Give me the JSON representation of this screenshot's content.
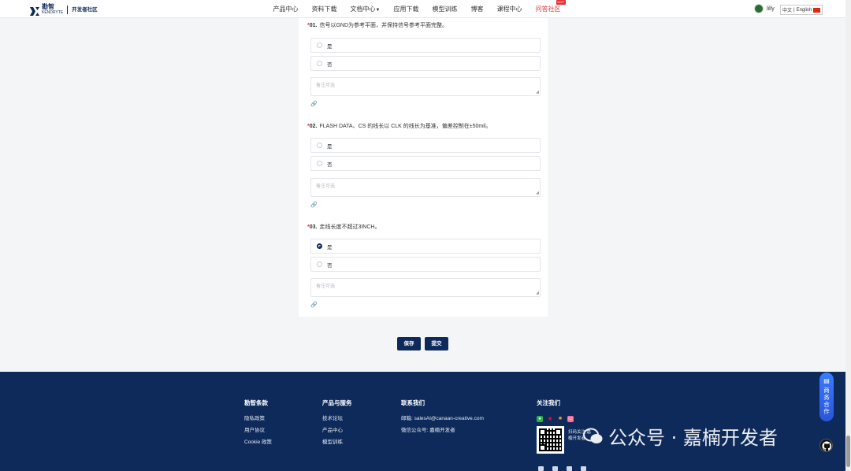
{
  "nav": {
    "logo_cn": "勘智",
    "logo_en": "KENDRYTE",
    "community": "开发者社区",
    "menu": [
      "产品中心",
      "资料下载",
      "文档中心",
      "应用下载",
      "模型训练",
      "博客",
      "课程中心",
      "问答社区"
    ],
    "hot_badge": "HOT",
    "username": "lilly",
    "lang_cn": "中文",
    "lang_sep": "|",
    "lang_en": "English"
  },
  "questions": [
    {
      "required": "*",
      "number": "01.",
      "text": "信号以GND为参考平面，并保持信号参考平面完整。",
      "options": [
        "是",
        "否"
      ],
      "selected": null,
      "remark_placeholder": "备注可选"
    },
    {
      "required": "*",
      "number": "02.",
      "text": "FLASH DATA、CS 的线长以 CLK 的线长为基准，偏差控制在±50mil。",
      "options": [
        "是",
        "否"
      ],
      "selected": null,
      "remark_placeholder": "备注可选"
    },
    {
      "required": "*",
      "number": "03.",
      "text": "走线长度不超过3INCH。",
      "options": [
        "是",
        "否"
      ],
      "selected": 0,
      "remark_placeholder": "备注可选"
    }
  ],
  "actions": {
    "save": "保存",
    "submit": "提交"
  },
  "footer": {
    "col1": {
      "title": "勘智条款",
      "links": [
        "隐私政策",
        "用户协议",
        "Cookie 政策"
      ]
    },
    "col2": {
      "title": "产品与服务",
      "links": [
        "技术论坛",
        "产品中心",
        "模型训练"
      ]
    },
    "col3": {
      "title": "联系我们",
      "links": [
        "邮箱: salesAI@canaan-creative.com",
        "微信公众号: 嘉楠开发者"
      ]
    },
    "col4": {
      "title": "关注我们",
      "qr_caption": "扫码关注 嘉楠开发者"
    },
    "social_icons": [
      "wechat-icon",
      "weibo-icon",
      "bilibili-butterfly-icon",
      "bilibili-icon"
    ]
  },
  "float": {
    "label": "商务合作"
  },
  "watermark": {
    "text": "公众号 · 嘉楠开发者"
  },
  "colors": {
    "navy": "#0d2a5a",
    "red": "#e03131",
    "float_blue": "#3a7bff"
  }
}
